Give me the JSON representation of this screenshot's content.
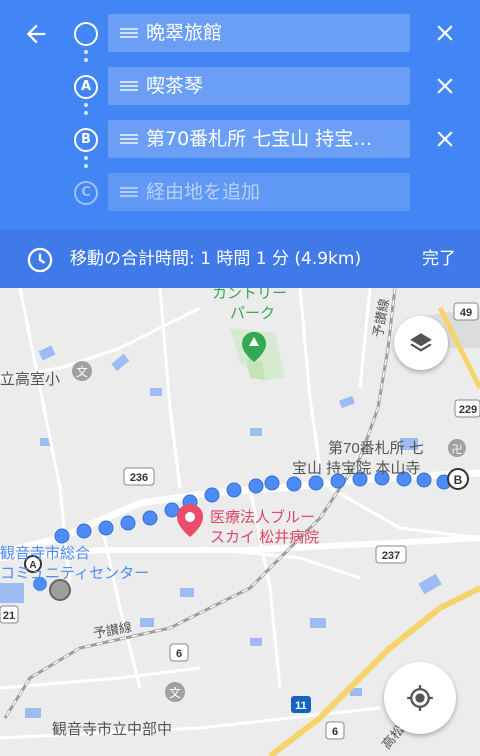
{
  "header": {
    "waypoints": [
      {
        "marker": "",
        "text": "晩翠旅館",
        "placeholder": false
      },
      {
        "marker": "A",
        "text": "喫茶琴",
        "placeholder": false
      },
      {
        "marker": "B",
        "text": "第70番札所 七宝山 持宝…",
        "placeholder": false
      },
      {
        "marker": "C",
        "text": "経由地を追加",
        "placeholder": true
      }
    ],
    "summary": "移動の合計時間: 1 時間 1 分 (4.9km)",
    "done_label": "完了"
  },
  "map": {
    "labels": {
      "park": "カントリー\nパーク",
      "park_line1": "カントリー",
      "park_line2": "パーク",
      "school_left": "立高室小",
      "temple_line1": "第70番札所 七",
      "temple_line2": "宝山 持宝院 本山寺",
      "hospital_line1": "医療法人ブルー",
      "hospital_line2": "スカイ 松井病院",
      "community_line1": "観音寺市総合",
      "community_line2": "コミュニティセンター",
      "rail_top": "予讃線",
      "rail_bottom": "予讃線",
      "school_bottom": "観音寺市立中部中",
      "school_icon": "文",
      "road_49": "49",
      "road_229": "229",
      "road_236": "236",
      "road_237": "237",
      "road_21": "21",
      "road_6a": "6",
      "road_6b": "6",
      "road_11": "11",
      "road_kanji": "高松"
    }
  },
  "colors": {
    "header": "#4285f4",
    "route": "#4e8cf5"
  }
}
